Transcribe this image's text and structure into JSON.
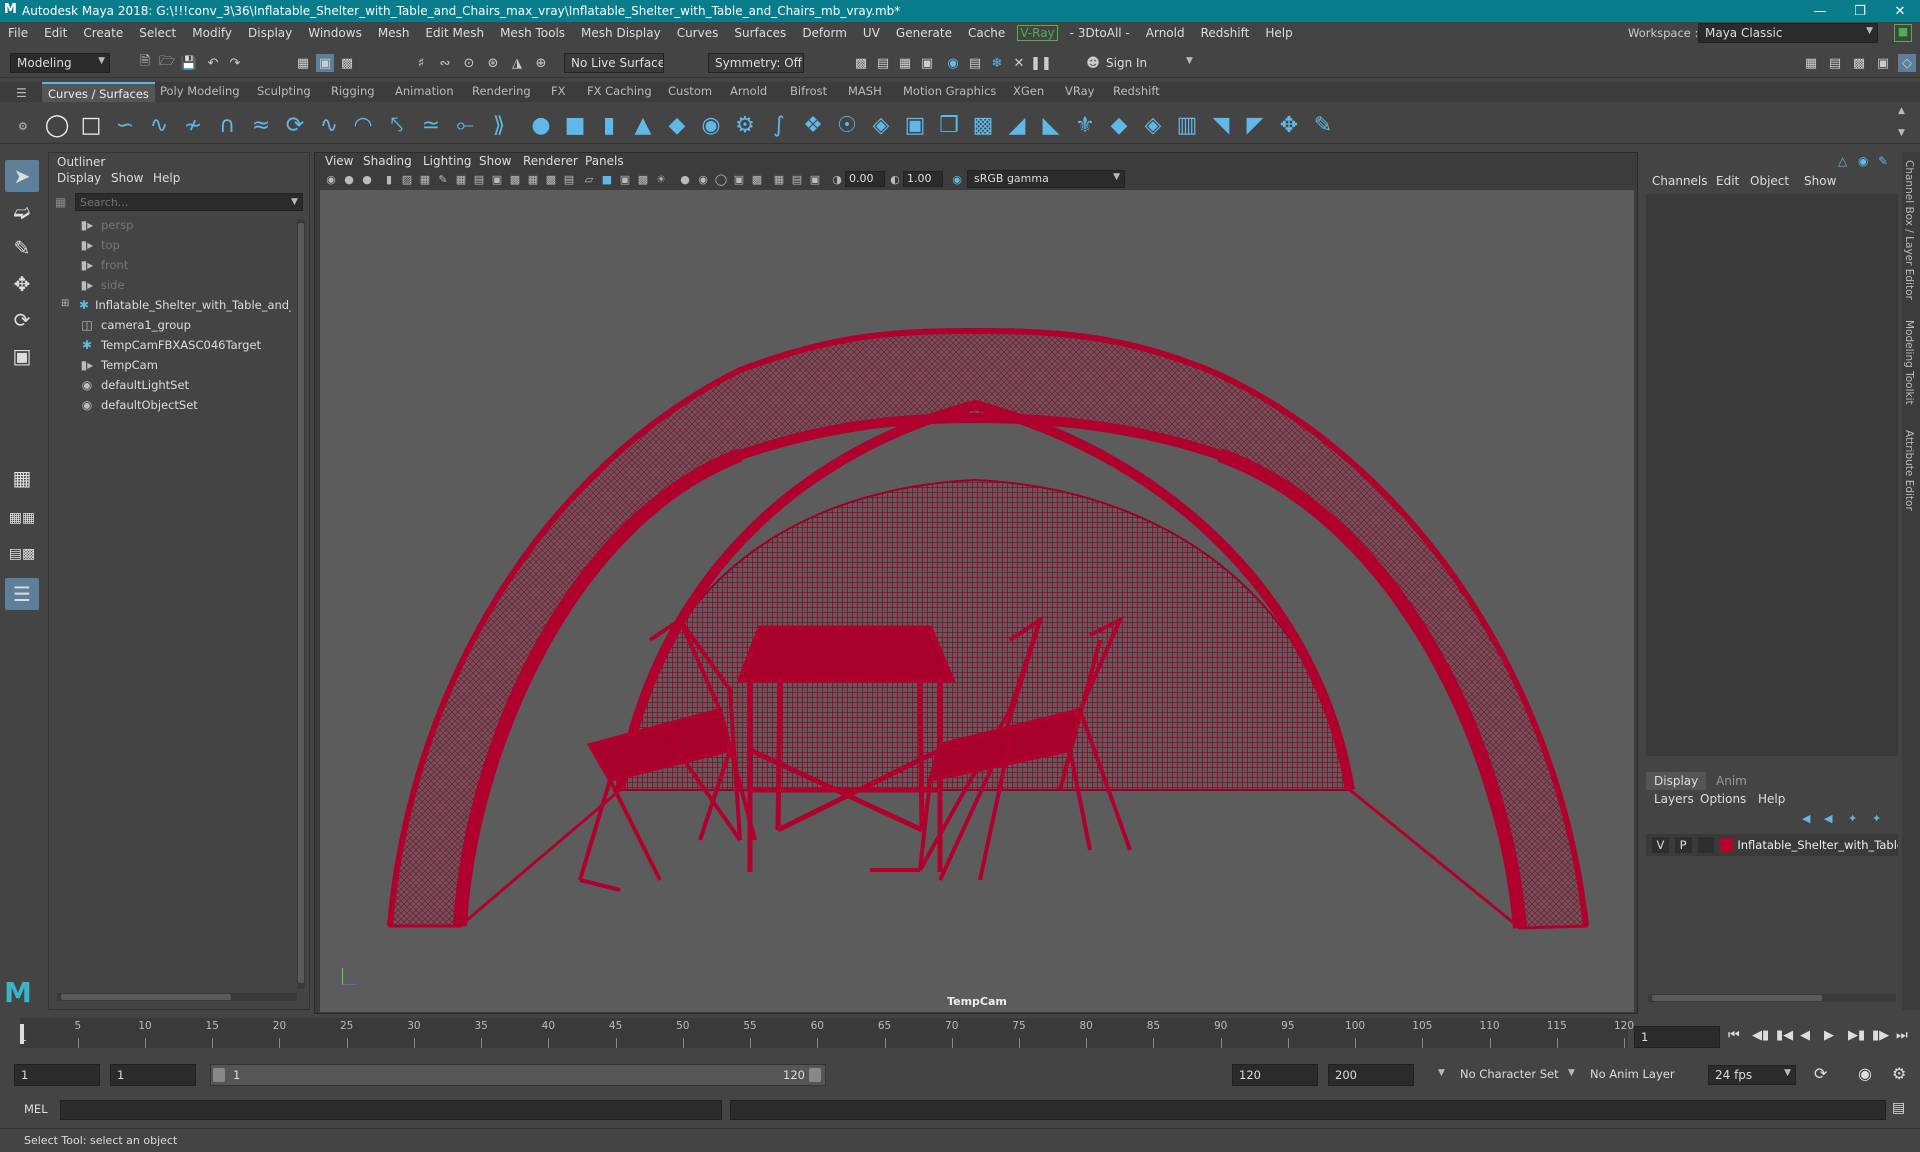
{
  "app": {
    "title": "Autodesk Maya 2018: G:\\!!!conv_3\\36\\Inflatable_Shelter_with_Table_and_Chairs_max_vray\\Inflatable_Shelter_with_Table_and_Chairs_mb_vray.mb*",
    "window_controls": [
      "minimize-icon",
      "restore-icon",
      "close-icon"
    ]
  },
  "menubar": {
    "items": [
      "File",
      "Edit",
      "Create",
      "Select",
      "Modify",
      "Display",
      "Windows",
      "Mesh",
      "Edit Mesh",
      "Mesh Tools",
      "Mesh Display",
      "Curves",
      "Surfaces",
      "Deform",
      "UV",
      "Generate",
      "Cache",
      "V-Ray",
      "- 3DtoAll -",
      "Arnold",
      "Redshift",
      "Help"
    ],
    "workspace_label": "Workspace :",
    "workspace_value": "Maya Classic"
  },
  "statusline": {
    "mode": "Modeling",
    "live_surface": "No Live Surface",
    "symmetry": "Symmetry: Off",
    "sign_in": "Sign In"
  },
  "shelf": {
    "tabs": [
      "Curves / Surfaces",
      "Poly Modeling",
      "Sculpting",
      "Rigging",
      "Animation",
      "Rendering",
      "FX",
      "FX Caching",
      "Custom",
      "Arnold",
      "Bifrost",
      "MASH",
      "Motion Graphics",
      "XGen",
      "VRay",
      "Redshift"
    ],
    "active_tab": "Curves / Surfaces"
  },
  "outliner": {
    "title": "Outliner",
    "menu": [
      "Display",
      "Show",
      "Help"
    ],
    "search_placeholder": "Search...",
    "items": [
      {
        "label": "persp",
        "icon": "camera-icon",
        "dim": true
      },
      {
        "label": "top",
        "icon": "camera-icon",
        "dim": true
      },
      {
        "label": "front",
        "icon": "camera-icon",
        "dim": true
      },
      {
        "label": "side",
        "icon": "camera-icon",
        "dim": true
      },
      {
        "label": "Inflatable_Shelter_with_Table_and_Ch",
        "icon": "transform-icon",
        "dim": false
      },
      {
        "label": "camera1_group",
        "icon": "group-icon",
        "dim": false
      },
      {
        "label": "TempCamFBXASC046Target",
        "icon": "transform-icon",
        "dim": false
      },
      {
        "label": "TempCam",
        "icon": "camera-icon",
        "dim": false
      },
      {
        "label": "defaultLightSet",
        "icon": "set-icon",
        "dim": false
      },
      {
        "label": "defaultObjectSet",
        "icon": "set-icon",
        "dim": false
      }
    ]
  },
  "viewport": {
    "menu": [
      "View",
      "Shading",
      "Lighting",
      "Show",
      "Renderer",
      "Panels"
    ],
    "exposure": "0.00",
    "gamma": "1.00",
    "color_space": "sRGB gamma",
    "camera_label": "TempCam",
    "wire_color": "#b0002e",
    "bg_color": "#5c5c5c"
  },
  "channelbox": {
    "menu": [
      "Channels",
      "Edit",
      "Object",
      "Show"
    ],
    "layer_tabs": [
      "Display",
      "Anim"
    ],
    "layer_menu": [
      "Layers",
      "Options",
      "Help"
    ],
    "layer": {
      "v": "V",
      "p": "P",
      "name": "Inflatable_Shelter_with_Table_",
      "color": "#b8002f"
    },
    "side_tabs": [
      "Channel Box / Layer Editor",
      "Modeling Toolkit",
      "Attribute Editor"
    ]
  },
  "timeline": {
    "ticks": [
      5,
      10,
      15,
      20,
      25,
      30,
      35,
      40,
      45,
      50,
      55,
      60,
      65,
      70,
      75,
      80,
      85,
      90,
      95,
      100,
      105,
      110,
      115,
      120
    ],
    "min": 1,
    "max": 120,
    "current_frame": "1",
    "first_tick_label": "1"
  },
  "range": {
    "start": "1",
    "playback_start": "1",
    "slider_start": "1",
    "slider_end": "120",
    "playback_end": "120",
    "end": "200",
    "character_set": "No Character Set",
    "anim_layer": "No Anim Layer",
    "fps": "24 fps"
  },
  "cmdline": {
    "label": "MEL"
  },
  "helpline": {
    "text": "Select Tool: select an object"
  }
}
